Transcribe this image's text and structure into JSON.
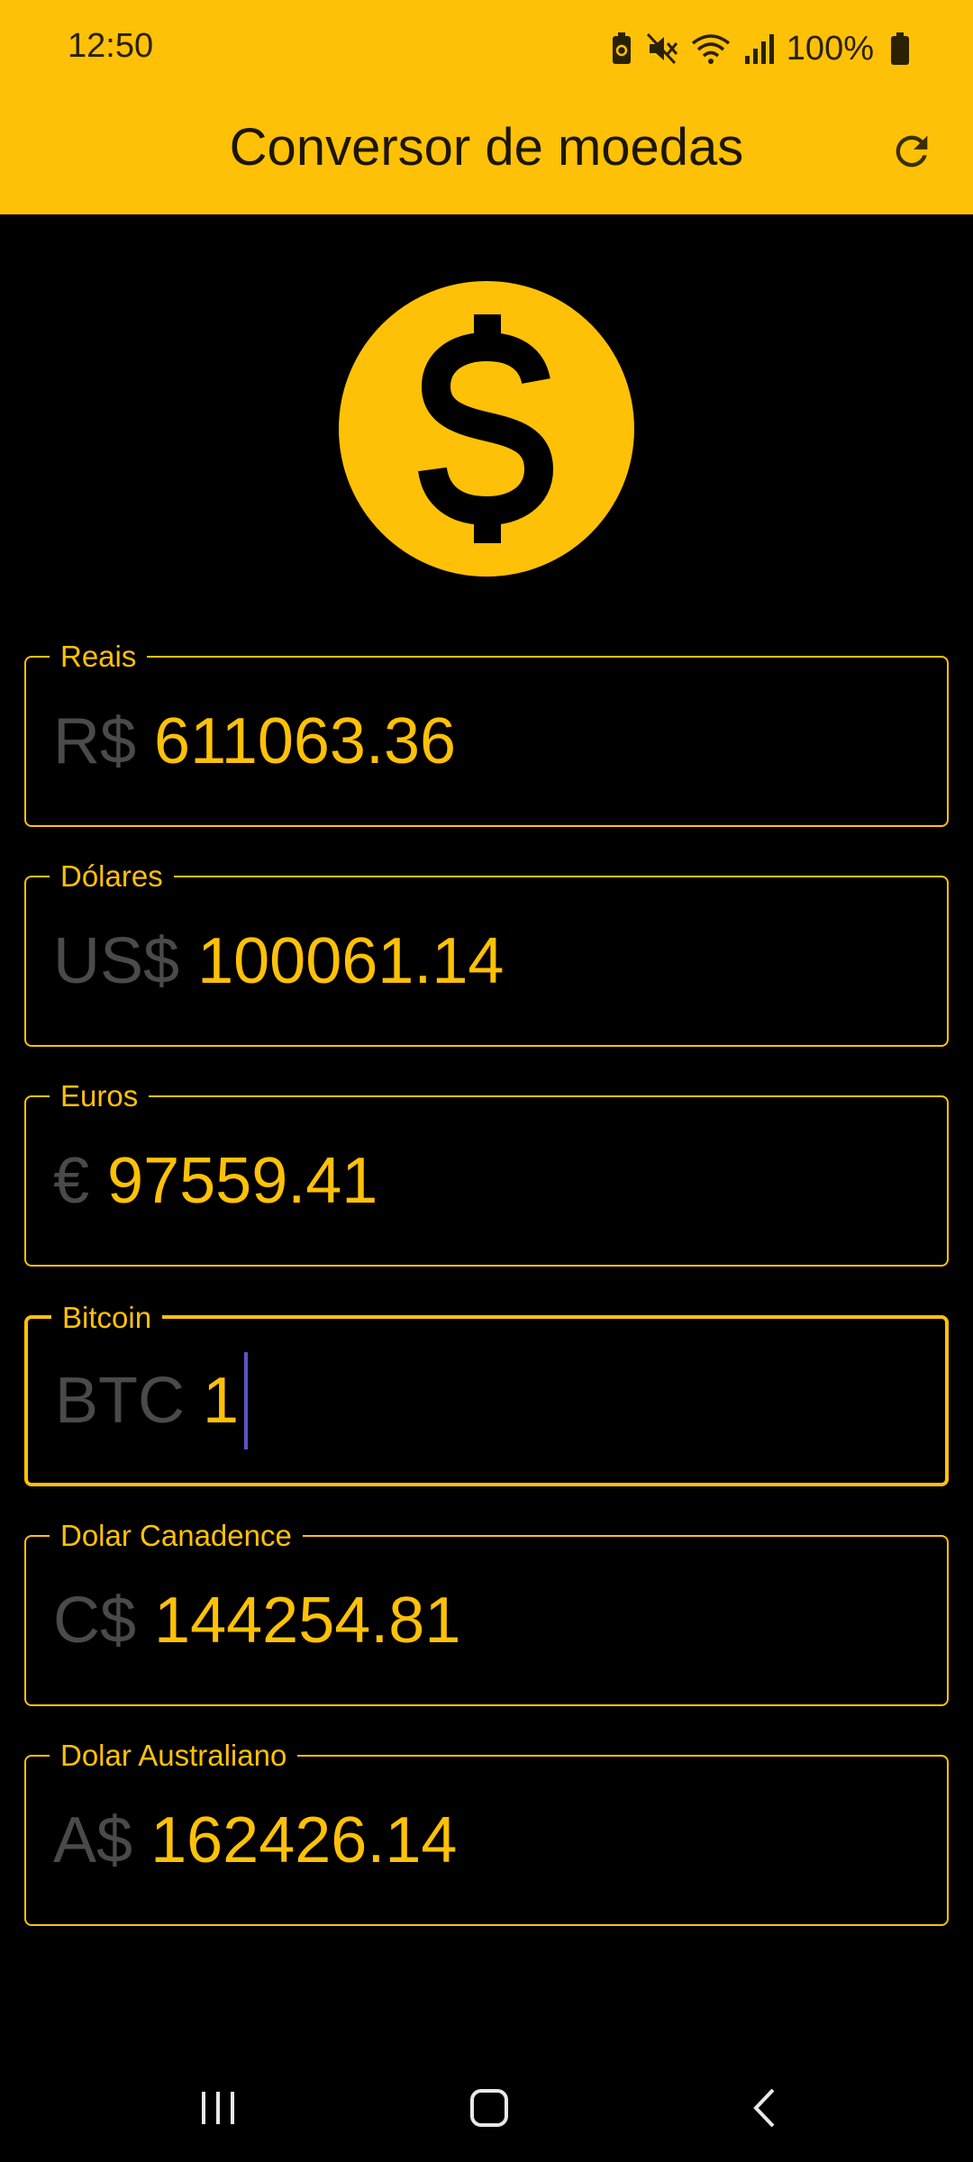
{
  "status_bar": {
    "time": "12:50",
    "battery_text": "100%"
  },
  "app_bar": {
    "title": "Conversor de moedas",
    "refresh_icon": "refresh-icon"
  },
  "logo_icon": "dollar-coin-icon",
  "fields": [
    {
      "label": "Reais",
      "prefix": "R$",
      "value": "611063.36"
    },
    {
      "label": "Dólares",
      "prefix": "US$",
      "value": "100061.14"
    },
    {
      "label": "Euros",
      "prefix": "€",
      "value": "97559.41"
    },
    {
      "label": "Bitcoin",
      "prefix": "BTC",
      "value": "1"
    },
    {
      "label": "Dolar Canadence",
      "prefix": "C$",
      "value": "144254.81"
    },
    {
      "label": "Dolar Australiano",
      "prefix": "A$",
      "value": "162426.14"
    }
  ],
  "colors": {
    "accent": "#FFC107",
    "background": "#000000",
    "prefix": "#4a4a4a",
    "cursor": "#5a55c8"
  }
}
